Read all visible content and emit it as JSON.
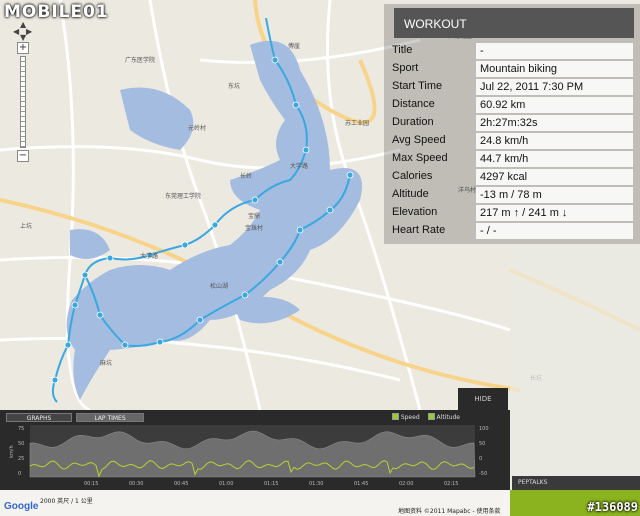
{
  "watermark": "MOBILE01",
  "panel": {
    "title": "WORKOUT",
    "rows": [
      {
        "label": "Title",
        "value": "-"
      },
      {
        "label": "Sport",
        "value": "Mountain biking"
      },
      {
        "label": "Start Time",
        "value": "Jul 22, 2011 7:30 PM"
      },
      {
        "label": "Distance",
        "value": "60.92 km"
      },
      {
        "label": "Duration",
        "value": "2h:27m:32s"
      },
      {
        "label": "Avg Speed",
        "value": "24.8 km/h"
      },
      {
        "label": "Max Speed",
        "value": "44.7 km/h"
      },
      {
        "label": "Calories",
        "value": "4297 kcal"
      },
      {
        "label": "Altitude",
        "value": "-13 m / 78 m"
      },
      {
        "label": "Elevation",
        "value": "217 m ↑ / 241 m ↓"
      },
      {
        "label": "Heart Rate",
        "value": "- / -"
      }
    ]
  },
  "graphs": {
    "tabs": [
      "GRAPHS",
      "LAP TIMES"
    ],
    "legend": {
      "speed": "Speed",
      "altitude": "Altitude"
    },
    "hide_label": "HIDE",
    "y_left_unit": "km/h",
    "y_left_ticks": [
      "75",
      "50",
      "25",
      "0"
    ],
    "y_right_ticks": [
      "100",
      "50",
      "0",
      "-50"
    ],
    "x_ticks": [
      "00:15",
      "00:30",
      "00:45",
      "01:00",
      "01:15",
      "01:30",
      "01:45",
      "02:00",
      "02:15"
    ],
    "speed_color": "#b5d334",
    "altitude_color": "#777777"
  },
  "peptalks_label": "PEPTALKS",
  "footer": {
    "logo": "Google",
    "scale": "2000 英尺 / 1 公里",
    "copyright": "地图资料 ©2011 Mapabc - 使用条款"
  },
  "badge": "#136089",
  "map_labels": [
    "傅崖",
    "长塘花园",
    "大宇路",
    "松山湖",
    "大学路",
    "宝鼎",
    "宝珠村",
    "长岭",
    "元岭村",
    "东坑",
    "苏工业园",
    "上坑",
    "麻坑",
    "芦溪",
    "西坑",
    "土地",
    "东莞理工学院",
    "广东医学院",
    "洋乌村",
    "长坑"
  ],
  "route_color": "#3aa8e0",
  "water_color": "#a4bce0"
}
